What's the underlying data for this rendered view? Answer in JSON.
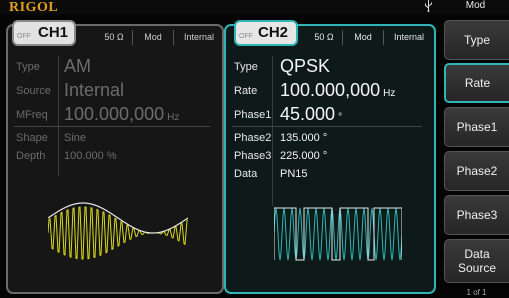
{
  "brand": "RIGOL",
  "menu_title": "Mod",
  "ch1": {
    "name": "CH1",
    "state": "OFF",
    "impedance": "50 Ω",
    "mode": "Mod",
    "source": "Internal",
    "params": {
      "type_label": "Type",
      "type_value": "AM",
      "source_label": "Source",
      "source_value": "Internal",
      "mfreq_label": "MFreq",
      "mfreq_value": "100.000,000",
      "mfreq_unit": "Hz",
      "shape_label": "Shape",
      "shape_value": "Sine",
      "depth_label": "Depth",
      "depth_value": "100.000 %"
    }
  },
  "ch2": {
    "name": "CH2",
    "state": "OFF",
    "impedance": "50 Ω",
    "mode": "Mod",
    "source": "Internal",
    "params": {
      "type_label": "Type",
      "type_value": "QPSK",
      "rate_label": "Rate",
      "rate_value": "100.000,000",
      "rate_unit": "Hz",
      "phase1_label": "Phase1",
      "phase1_value": "45.000",
      "phase1_unit": "°",
      "phase2_label": "Phase2",
      "phase2_value": "135.000 °",
      "phase3_label": "Phase3",
      "phase3_value": "225.000 °",
      "data_label": "Data",
      "data_value": "PN15"
    }
  },
  "softkeys": [
    {
      "label": "Type",
      "active": false
    },
    {
      "label": "Rate",
      "active": true
    },
    {
      "label": "Phase1",
      "active": false
    },
    {
      "label": "Phase2",
      "active": false
    },
    {
      "label": "Phase3",
      "active": false
    },
    {
      "label": "Data Source",
      "active": false
    }
  ],
  "page_indicator": "1 of 1",
  "colors": {
    "ch1_waveform": "#d8d820",
    "ch2_waveform": "#2fb5b5",
    "ch2_border": "#2fb5b5",
    "brand": "#e0a020"
  },
  "icons": {
    "usb": "usb-icon"
  }
}
